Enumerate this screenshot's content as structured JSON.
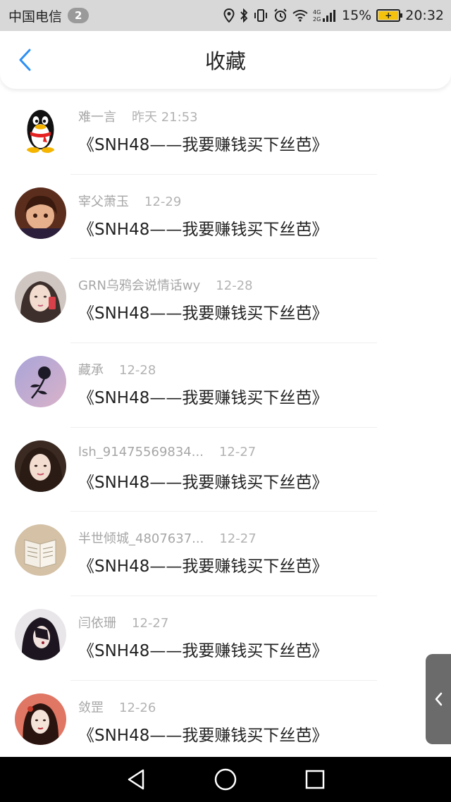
{
  "status_bar": {
    "carrier": "中国电信",
    "notification_count": "2",
    "signal_label": "4G 2G",
    "battery_percent": "15%",
    "battery_charging_symbol": "+",
    "time": "20:32"
  },
  "header": {
    "title": "收藏"
  },
  "favorites": [
    {
      "name": "难一言",
      "time": "昨天 21:53",
      "title": "《SNH48——我要赚钱买下丝芭》",
      "avatar": "qq-penguin"
    },
    {
      "name": "宰父萧玉",
      "time": "12-29",
      "title": "《SNH48——我要赚钱买下丝芭》",
      "avatar": "anime-boy"
    },
    {
      "name": "GRN乌鸦会说情话wy",
      "time": "12-28",
      "title": "《SNH48——我要赚钱买下丝芭》",
      "avatar": "girl-photo"
    },
    {
      "name": "藏承",
      "time": "12-28",
      "title": "《SNH48——我要赚钱买下丝芭》",
      "avatar": "rose-silhouette"
    },
    {
      "name": "lsh_91475569834...",
      "time": "12-27",
      "title": "《SNH48——我要赚钱买下丝芭》",
      "avatar": "girl-portrait"
    },
    {
      "name": "半世倾城_4807637...",
      "time": "12-27",
      "title": "《SNH48——我要赚钱买下丝芭》",
      "avatar": "open-book"
    },
    {
      "name": "闫依珊",
      "time": "12-27",
      "title": "《SNH48——我要赚钱买下丝芭》",
      "avatar": "anime-dark"
    },
    {
      "name": "敛罡",
      "time": "12-26",
      "title": "《SNH48——我要赚钱买下丝芭》",
      "avatar": "ink-girl"
    }
  ],
  "colors": {
    "accent": "#2c8ff5",
    "status_bar_bg": "#d8d8d8",
    "name_text": "#a6a6a6",
    "title_text": "#222222",
    "nav_bar_bg": "#000000"
  }
}
